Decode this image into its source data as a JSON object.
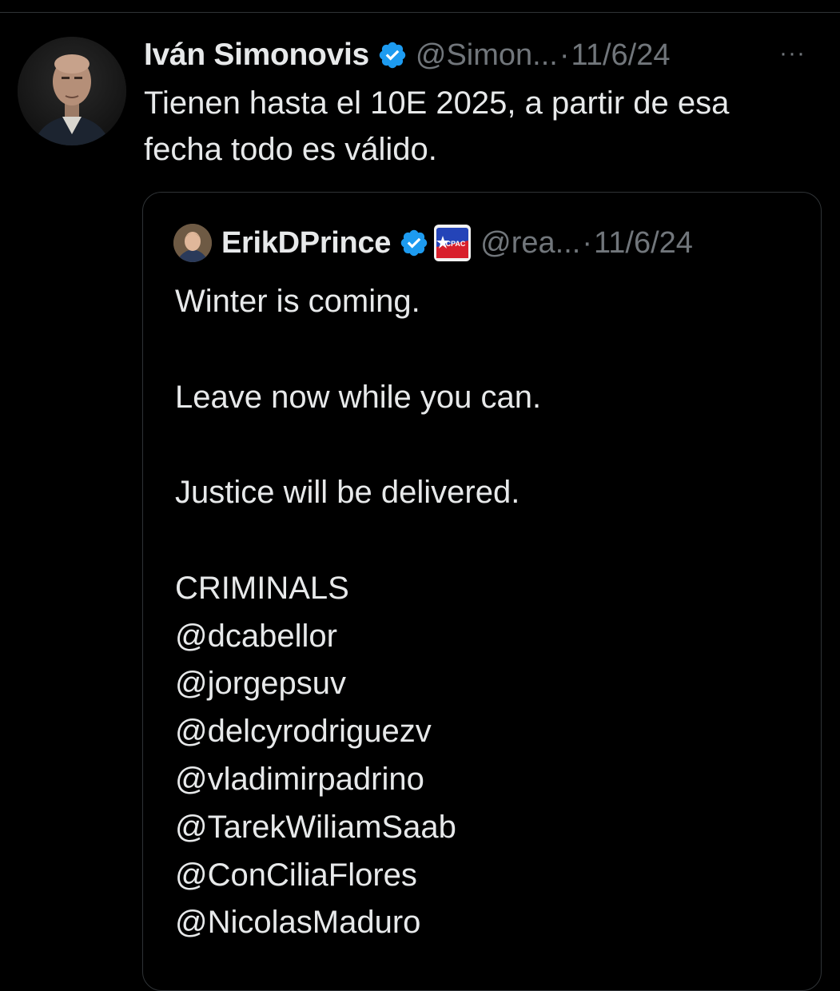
{
  "tweet": {
    "author_name": "Iván Simonovis",
    "handle": "@Simon...",
    "separator": "·",
    "date": "11/6/24",
    "more_label": "···",
    "text": "Tienen hasta el 10E 2025, a partir de esa\nfecha todo es válido."
  },
  "quoted_tweet": {
    "author_name": "ErikDPrince",
    "handle": "@rea...",
    "separator": "·",
    "date": "11/6/24",
    "affiliate_badge_text": "CPAC",
    "text": "Winter is coming.\n\nLeave now while you can.\n\nJustice will be delivered.\n\nCRIMINALS\n@dcabellor\n@jorgepsuv\n@delcyrodriguezv\n@vladimirpadrino\n@TarekWiliamSaab\n@ConCiliaFlores\n@NicolasMaduro"
  },
  "icons": {
    "verified": "verified-badge-icon",
    "more": "more-options-icon",
    "affiliate": "cpac-affiliate-icon"
  },
  "colors": {
    "background": "#000000",
    "text_primary": "#e7e9ea",
    "text_secondary": "#71767b",
    "verified_blue": "#1d9bf0",
    "border": "#2f3336"
  }
}
